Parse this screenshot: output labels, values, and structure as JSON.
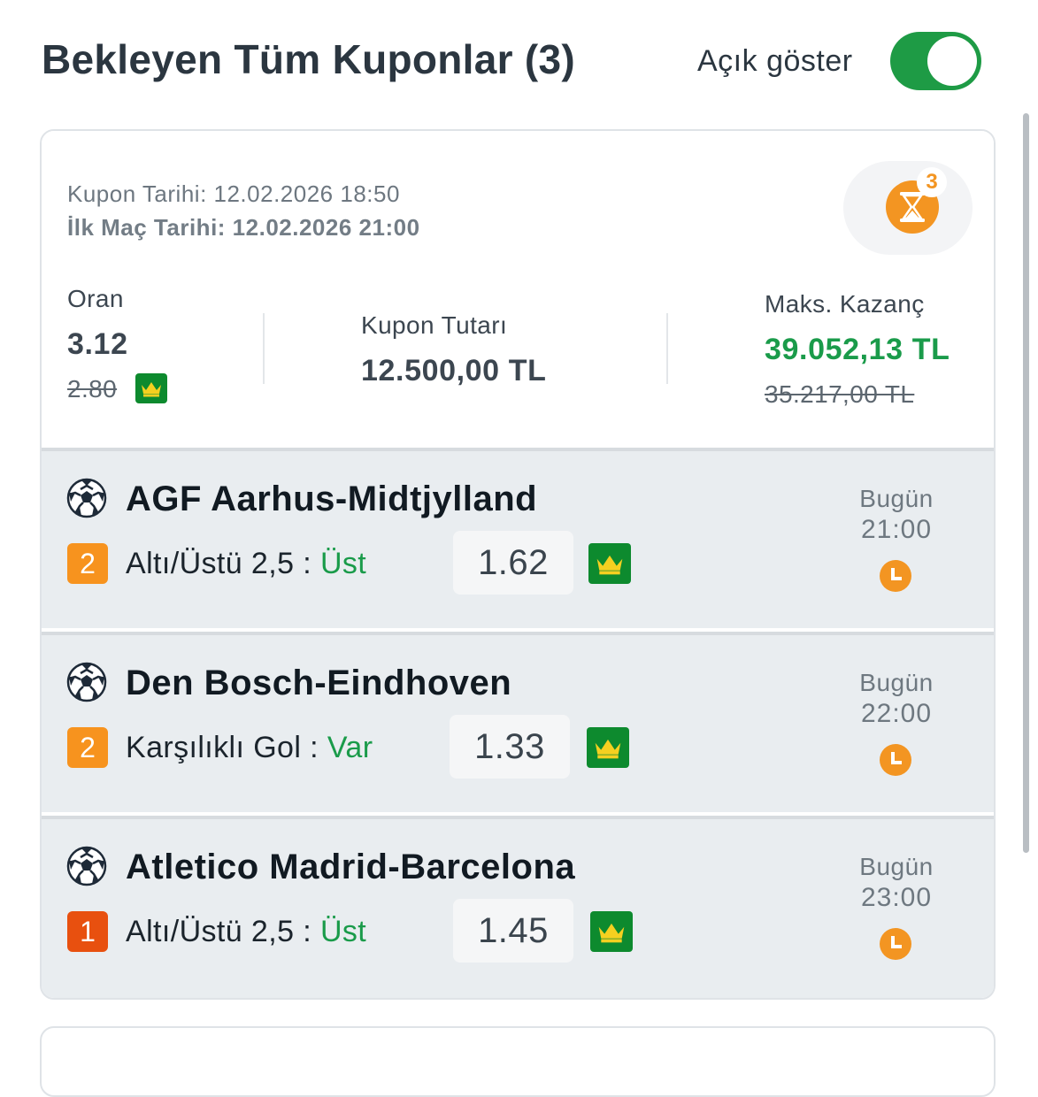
{
  "header": {
    "title": "Bekleyen Tüm Kuponlar (3)",
    "toggle_label": "Açık göster",
    "toggle_on": true
  },
  "coupon": {
    "coupon_date": "Kupon Tarihi: 12.02.2026 18:50",
    "first_match_date": "İlk Maç Tarihi: 12.02.2026 21:00",
    "pending_count": "3",
    "odds_label": "Oran",
    "odds_value": "3.12",
    "odds_old": "2.80",
    "amount_label": "Kupon Tutarı",
    "amount_value": "12.500,00 TL",
    "max_win_label": "Maks. Kazanç",
    "max_win_value": "39.052,13 TL",
    "max_win_old": "35.217,00 TL",
    "accent_color": "#1a9b4a",
    "status_color": "#f39522"
  },
  "matches": [
    {
      "title": "AGF Aarhus-Midtjylland",
      "rank": "2",
      "market": "Altı/Üstü 2,5 : ",
      "selection": "Üst",
      "odd": "1.62",
      "day": "Bugün",
      "time": "21:00",
      "icon": "soccer-ball-icon"
    },
    {
      "title": "Den Bosch-Eindhoven",
      "rank": "2",
      "market": "Karşılıklı Gol : ",
      "selection": "Var",
      "odd": "1.33",
      "day": "Bugün",
      "time": "22:00",
      "icon": "soccer-ball-icon"
    },
    {
      "title": "Atletico Madrid-Barcelona",
      "rank": "1",
      "market": "Altı/Üstü 2,5 : ",
      "selection": "Üst",
      "odd": "1.45",
      "day": "Bugün",
      "time": "23:00",
      "icon": "soccer-ball-icon"
    }
  ]
}
